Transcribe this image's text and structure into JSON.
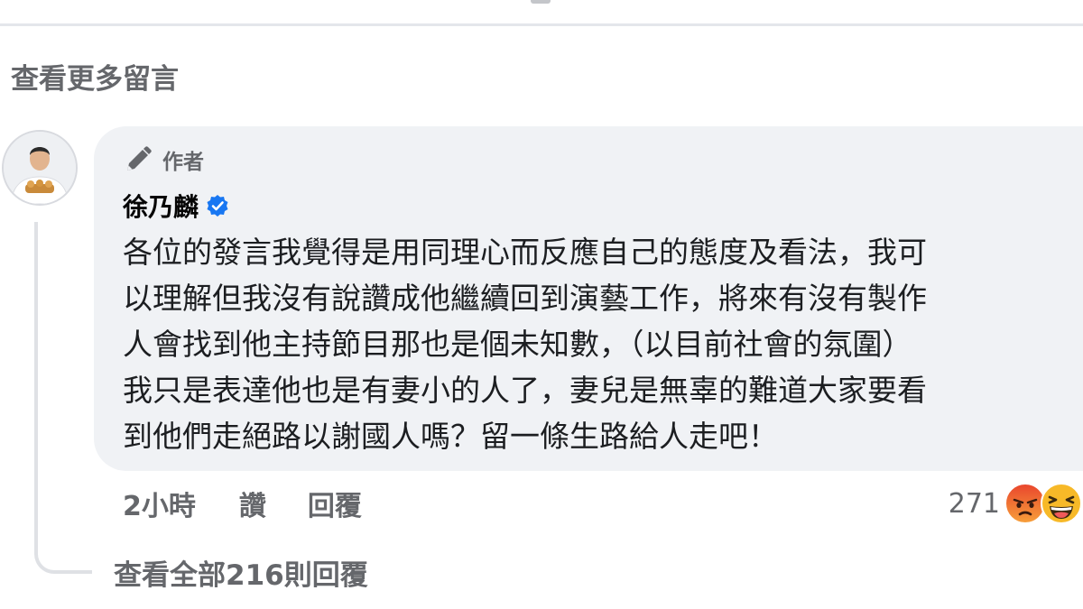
{
  "comments_section": {
    "view_more_label": "查看更多留言"
  },
  "comment": {
    "author_badge_label": "作者",
    "author_name": "徐乃麟",
    "verified": true,
    "text_lines": [
      "各位的發言我覺得是用同理心而反應自己的態度及看法，我可",
      "以理解但我沒有說讚成他繼續回到演藝工作，將來有沒有製作",
      "人會找到他主持節目那也是個未知數，（以目前社會的氛圍）",
      "我只是表達他也是有妻小的人了，妻兒是無辜的難道大家要看",
      "到他們走絕路以謝國人嗎？留一條生路給人走吧！"
    ],
    "time": "2小時",
    "like_label": "讚",
    "reply_label": "回覆",
    "reaction_count": "271",
    "reactions": [
      "angry-reaction-icon",
      "haha-reaction-icon"
    ],
    "view_replies_label": "查看全部216則回覆"
  },
  "colors": {
    "bubble_background": "#f0f2f5",
    "secondary_text": "#65676b",
    "verified_blue": "#1877f2",
    "angry_reaction": "#f06a3a",
    "haha_reaction": "#f7b928"
  }
}
